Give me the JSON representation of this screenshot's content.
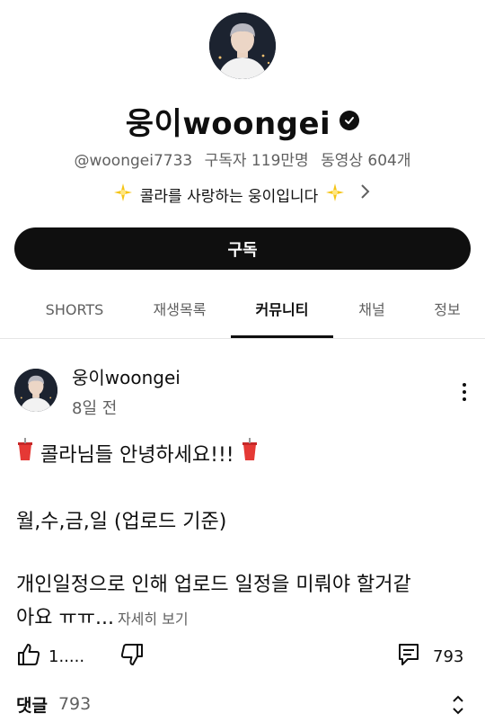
{
  "channel": {
    "name": "웅이woongei",
    "handle": "@woongei7733",
    "subscribers": "구독자 119만명",
    "videos": "동영상 604개",
    "description": "콜라를 사랑하는 웅이입니다",
    "subscribe_label": "구독"
  },
  "tabs": [
    {
      "label": "SHORTS"
    },
    {
      "label": "재생목록"
    },
    {
      "label": "커뮤니티"
    },
    {
      "label": "채널"
    },
    {
      "label": "정보"
    }
  ],
  "active_tab": "커뮤니티",
  "post": {
    "author": "웅이woongei",
    "time": "8일 전",
    "line1": "콜라님들 안녕하세요!!!",
    "line2": "월,수,금,일 (업로드 기준)",
    "line3": "개인일정으로 인해 업로드 일정을 미뤄야 할거같",
    "line4": "아요 ㅠㅠ...",
    "see_more": "자세히 보기",
    "likes": "1.....",
    "comment_count": "793"
  },
  "comments": {
    "label": "댓글",
    "count": "793"
  },
  "icons": {
    "verified": "verified-check-icon",
    "chevron": "chevron-right-icon",
    "menu": "more-vert-icon",
    "like": "thumb-up-icon",
    "dislike": "thumb-down-icon",
    "comment": "comment-icon",
    "expand": "unfold-icon",
    "sparkle": "sparkle-emoji-icon",
    "cup": "cola-cup-emoji-icon"
  }
}
